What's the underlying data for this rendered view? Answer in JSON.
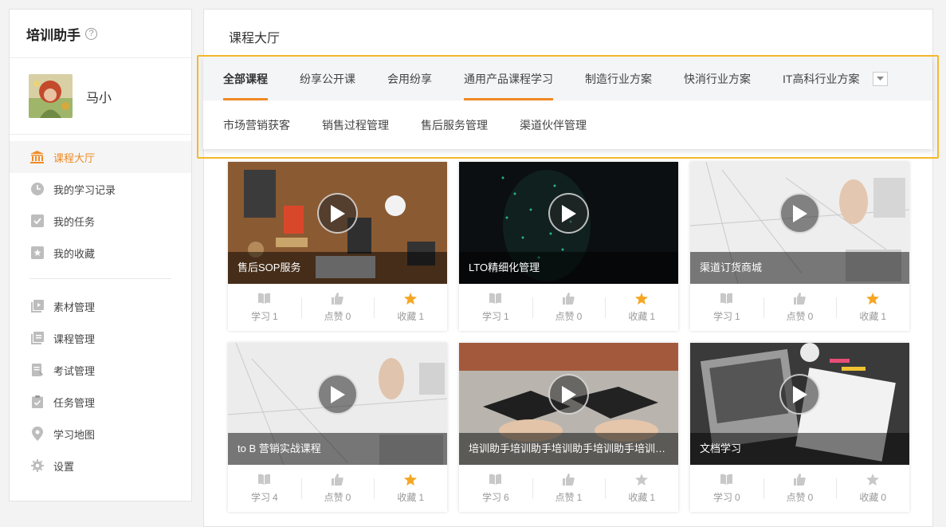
{
  "sidebar": {
    "title": "培训助手",
    "help_icon": "?",
    "user_name": "马小",
    "menu": [
      {
        "label": "课程大厅",
        "icon": "institution-icon",
        "active": true
      },
      {
        "label": "我的学习记录",
        "icon": "clock-icon"
      },
      {
        "label": "我的任务",
        "icon": "checkbox-icon"
      },
      {
        "label": "我的收藏",
        "icon": "star-box-icon"
      },
      {
        "label": "素材管理",
        "icon": "media-library-icon"
      },
      {
        "label": "课程管理",
        "icon": "course-list-icon"
      },
      {
        "label": "考试管理",
        "icon": "exam-icon"
      },
      {
        "label": "任务管理",
        "icon": "task-clipboard-icon"
      },
      {
        "label": "学习地图",
        "icon": "map-pin-icon"
      },
      {
        "label": "设置",
        "icon": "gear-icon"
      }
    ]
  },
  "main": {
    "title": "课程大厅",
    "tabs_row1": [
      "全部课程",
      "纷享公开课",
      "会用纷享",
      "通用产品课程学习",
      "制造行业方案",
      "快消行业方案",
      "IT高科行业方案"
    ],
    "tabs_row2": [
      "市场营销获客",
      "销售过程管理",
      "售后服务管理",
      "渠道伙伴管理"
    ],
    "stat_labels": {
      "study": "学习",
      "like": "点赞",
      "fav": "收藏"
    },
    "courses": [
      {
        "title": "售后SOP服务",
        "study": "1",
        "like": "0",
        "fav": "1",
        "starred": true
      },
      {
        "title": "LTO精细化管理",
        "study": "1",
        "like": "0",
        "fav": "1",
        "starred": true
      },
      {
        "title": "渠道订货商城",
        "study": "1",
        "like": "0",
        "fav": "1",
        "starred": true
      },
      {
        "title": "to B 营销实战课程",
        "study": "4",
        "like": "0",
        "fav": "1",
        "starred": true
      },
      {
        "title": "培训助手培训助手培训助手培训助手培训助手培训助手",
        "study": "6",
        "like": "1",
        "fav": "1",
        "starred": false
      },
      {
        "title": "文档学习",
        "study": "0",
        "like": "0",
        "fav": "0",
        "starred": false
      }
    ]
  },
  "colors": {
    "accent": "#f08a24",
    "highlight_border": "#f4b92b"
  }
}
